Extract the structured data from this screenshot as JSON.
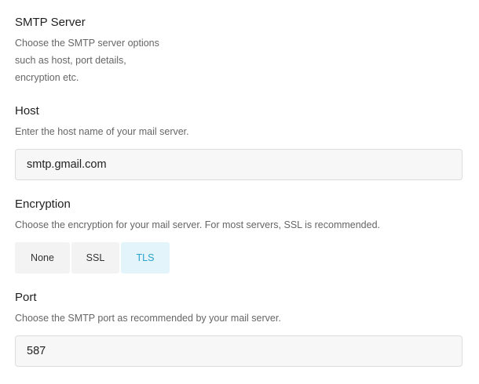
{
  "smtp_server": {
    "title": "SMTP Server",
    "description_lines": [
      "Choose the SMTP server options",
      "such as host, port details,",
      "encryption etc."
    ]
  },
  "host": {
    "label": "Host",
    "description": "Enter the host name of your mail server.",
    "value": "smtp.gmail.com"
  },
  "encryption": {
    "label": "Encryption",
    "description": "Choose the encryption for your mail server. For most servers, SSL is recommended.",
    "options": [
      "None",
      "SSL",
      "TLS"
    ],
    "selected": "TLS",
    "accent_color": "#2aa3cf",
    "accent_bg": "#e3f4fb"
  },
  "port": {
    "label": "Port",
    "description": "Choose the SMTP port as recommended by your mail server.",
    "value": "587"
  }
}
